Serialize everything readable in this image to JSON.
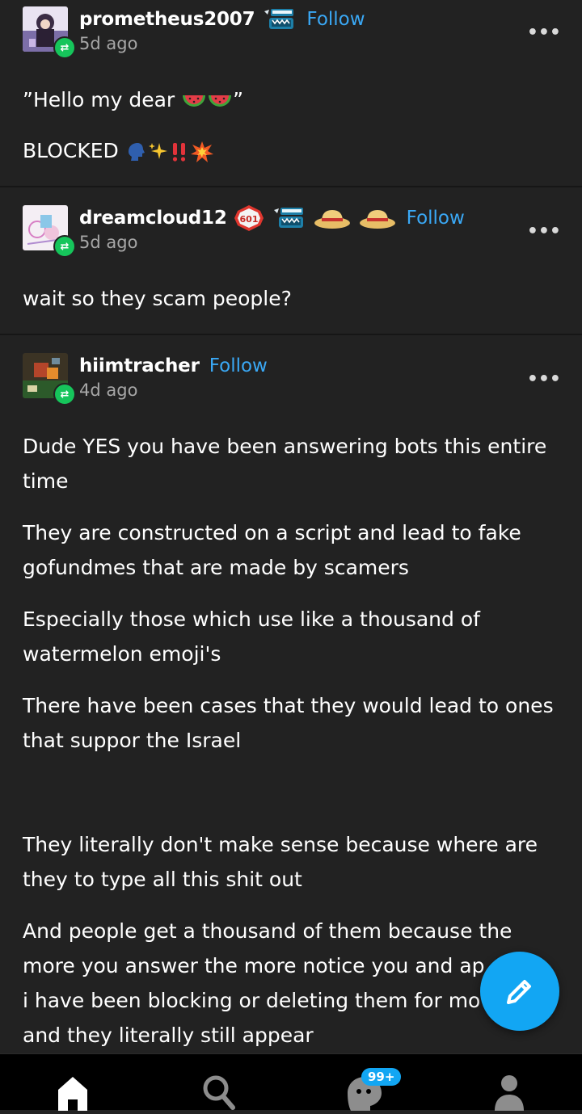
{
  "posts": [
    {
      "username": "prometheus2007",
      "follow_label": "Follow",
      "time": "5d ago",
      "more_label": "•••",
      "paragraphs": [
        "”Hello my dear",
        "BLOCKED"
      ],
      "quote_close": "”",
      "badges": [
        "toothy-badge-icon"
      ],
      "emojis_line1": [
        "watermelon-icon",
        "watermelon-icon"
      ],
      "emojis_line2": [
        "speaking-head-icon",
        "sparkles-icon",
        "double-exclamation-icon",
        "collision-icon"
      ]
    },
    {
      "username": "dreamcloud12",
      "follow_label": "Follow",
      "time": "5d ago",
      "more_label": "•••",
      "badge_number": "601",
      "paragraphs": [
        "wait so they scam people?"
      ],
      "badges": [
        "601-badge-icon",
        "toothy-badge-icon",
        "straw-hat-icon",
        "straw-hat-icon"
      ]
    },
    {
      "username": "hiimtracher",
      "follow_label": "Follow",
      "time": "4d ago",
      "more_label": "•••",
      "paragraphs": [
        "Dude YES you have been answering bots this entire time",
        "They are constructed on a script and lead to fake gofundmes that are made by scamers",
        "Especially those which use like a thousand of watermelon emoji's",
        "There have been cases that they would lead to ones that suppor the Israel",
        "They literally don't make sense because where are they to type all this shit out",
        "And people get a thousand of them because the more you answer the more notice you and ap",
        "i have been blocking or deleting them for mo",
        "and they literally still appear"
      ]
    }
  ],
  "nav": {
    "items": [
      "home-icon",
      "search-icon",
      "activity-icon",
      "account-icon"
    ],
    "activity_count": "99+"
  },
  "fab": {
    "icon": "pencil-icon"
  },
  "colors": {
    "background": "#222222",
    "accent": "#3aa8f5",
    "fab": "#12a6f3",
    "reblog": "#16c55b"
  }
}
